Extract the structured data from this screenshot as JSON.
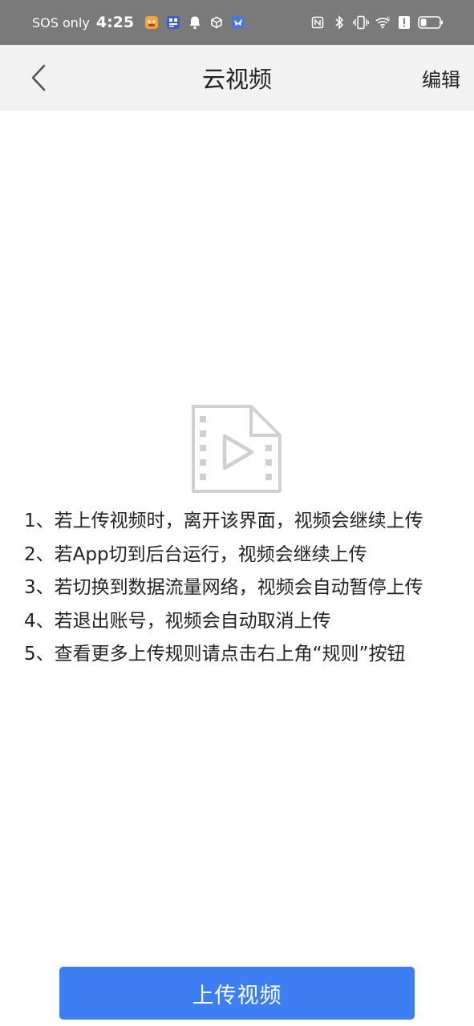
{
  "status_bar": {
    "carrier": "SOS only",
    "time": "4:25",
    "left_icons": [
      "app-notification-icon",
      "qr-app-icon",
      "bell-icon",
      "cube-icon",
      "bird-app-icon"
    ],
    "right_icons": [
      "nfc-icon",
      "bluetooth-icon",
      "vibrate-icon",
      "wifi-icon",
      "alert-icon",
      "battery-icon"
    ]
  },
  "navbar": {
    "title": "云视频",
    "edit_label": "编辑"
  },
  "empty_state": {
    "icon": "video-file-icon",
    "rules": [
      "1、若上传视频时，离开该界面，视频会继续上传",
      "2、若App切到后台运行，视频会继续上传",
      "3、若切换到数据流量网络，视频会自动暂停上传",
      "4、若退出账号，视频会自动取消上传",
      "5、查看更多上传规则请点击右上角“规则”按钮"
    ]
  },
  "upload_button_label": "上传视频",
  "colors": {
    "status_bar_bg": "#7a7a7a",
    "navbar_bg": "#f2f2f2",
    "accent": "#3d7ff2",
    "icon_gray": "#d0d0d0"
  }
}
